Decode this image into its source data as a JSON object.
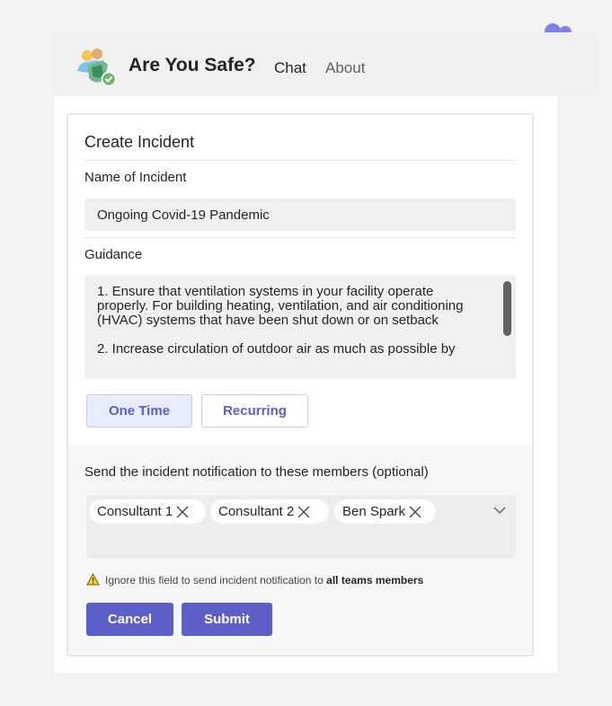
{
  "app": {
    "title": "Are You Safe?",
    "nav": [
      {
        "label": "Chat",
        "active": true
      },
      {
        "label": "About",
        "active": false
      }
    ]
  },
  "form": {
    "heading": "Create Incident",
    "name_label": "Name of Incident",
    "name_value": "Ongoing Covid-19 Pandemic",
    "guidance_label": "Guidance",
    "guidance_text": "1. Ensure that ventilation systems in your facility operate properly. For building heating, ventilation, and air conditioning (HVAC) systems that have been shut down or on setback\n\n2. Increase circulation of outdoor air as much as possible by",
    "frequency_options": [
      {
        "label": "One Time",
        "selected": true
      },
      {
        "label": "Recurring",
        "selected": false
      }
    ],
    "members_label": "Send the incident notification to these members (optional)",
    "members": [
      "Consultant 1",
      "Consultant 2",
      "Ben Spark"
    ],
    "warning_prefix": "Ignore this field to send incident notification to ",
    "warning_bold": "all teams members",
    "cancel_label": "Cancel",
    "submit_label": "Submit"
  },
  "colors": {
    "accent": "#5b5fc7",
    "accent_light": "#e8ebfa",
    "field_bg": "#f0f0f0",
    "warning": "#f8d22a"
  },
  "icons": {
    "app": "are-you-safe-icon",
    "teams": "teams-logo-icon",
    "remove": "close-icon",
    "dropdown": "chevron-down-icon",
    "warning": "warning-icon"
  }
}
